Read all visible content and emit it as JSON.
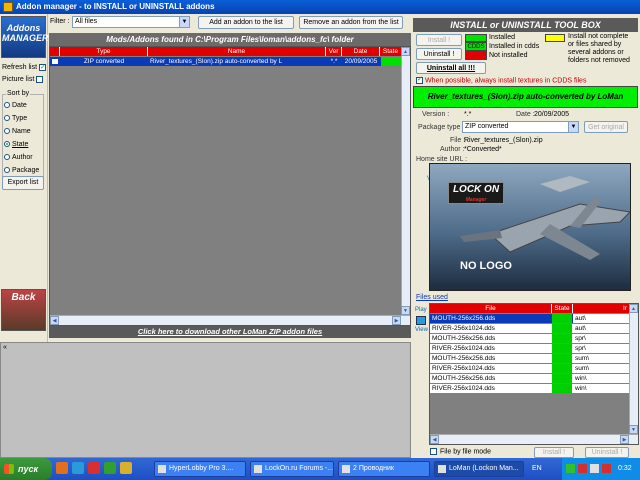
{
  "window": {
    "title": "Addon manager - to INSTALL or UNINSTALL addons"
  },
  "sidebar": {
    "logo_top": "Addons MANAGER",
    "refresh_list": "Refresh list",
    "picture_list": "Picture list",
    "sort_by": "Sort by",
    "sort_options": [
      "Date",
      "Type",
      "Name",
      "State",
      "Author",
      "Package"
    ],
    "selected_sort": "State",
    "export_list": "Export list",
    "back": "Back"
  },
  "toolbar": {
    "filter_label": "Filter :",
    "filter_value": "All files",
    "add_button": "Add an addon to the list",
    "remove_button": "Remove an addon from the list"
  },
  "mods": {
    "header": "Mods/Addons found in C:\\Program Files\\loman\\addons_fc\\ folder",
    "columns": [
      "Type",
      "Name",
      "Ver",
      "Date",
      "State",
      "Author"
    ],
    "rows": [
      {
        "type": "ZIP converted",
        "name": "River_textures_(Slon).zip auto-converted by L",
        "ver": "*.*",
        "date": "20/09/2005",
        "state_color": "#00e000",
        "author": "*Converted*"
      }
    ],
    "download_link": "Click here to download other LoMan ZIP addon files"
  },
  "toolbox": {
    "title": "INSTALL or UNINSTALL TOOL BOX",
    "install_button": "Install !",
    "uninstall_button": "Uninstall !",
    "uninstall_all_button": "Uninstall all !!!",
    "cdds_label": "CDDS",
    "legend_installed": "Installed",
    "legend_installed_cdds": "Installed in cdds",
    "legend_not_installed": "Not installed",
    "legend_incomplete": "Install not complete or files shared by several addons or folders not removed",
    "textures_checkbox": "When possible, always install textures in CDDS files",
    "banner": "River_textures_(Slon).zip auto-converted by LoMan",
    "version_label": "Version :",
    "version_value": "*.*",
    "date_label": "Date :",
    "date_value": "20/09/2005",
    "package_type_label": "Package type :",
    "package_type_value": "ZIP converted",
    "get_original_button": "Get original",
    "file_label": "File :",
    "file_value": "River_textures_(Slon).zip",
    "author_label": "Author :",
    "author_value": "*Converted*",
    "home_site_label": "Home site URL :",
    "view_label": "View",
    "preview_logo": "LOCK ON",
    "preview_logo_sub": "Manager",
    "preview_text": "NO LOGO",
    "files_used_label": "Files used",
    "play_label": "Play",
    "files_columns": [
      "File",
      "State",
      "Ir"
    ],
    "files": [
      {
        "file": "MOUTH-256x256.dds",
        "dir": "aut\\",
        "selected": true
      },
      {
        "file": "RIVER-256x1024.dds",
        "dir": "aut\\",
        "selected": false
      },
      {
        "file": "MOUTH-256x256.dds",
        "dir": "spr\\",
        "selected": false
      },
      {
        "file": "RIVER-256x1024.dds",
        "dir": "spr\\",
        "selected": false
      },
      {
        "file": "MOUTH-256x256.dds",
        "dir": "sum\\",
        "selected": false
      },
      {
        "file": "RIVER-256x1024.dds",
        "dir": "sum\\",
        "selected": false
      },
      {
        "file": "MOUTH-256x256.dds",
        "dir": "win\\",
        "selected": false
      },
      {
        "file": "RIVER-256x1024.dds",
        "dir": "win\\",
        "selected": false
      }
    ],
    "file_mode_label": "File by file mode",
    "install_bottom": "Install !",
    "uninstall_bottom": "Uninstall !"
  },
  "taskbar": {
    "start": "пуск",
    "tasks": [
      "HyperLobby Pro 3....",
      "LockOn.ru Forums -...",
      "2 Проводник",
      "LoMan (Lockon Man..."
    ],
    "active_task": 3,
    "lang": "EN",
    "clock": "0:32"
  },
  "colors": {
    "installed": "#00e000",
    "installed_cdds": "#00e000",
    "not_installed": "#e00000",
    "incomplete": "#ffff00",
    "header_red": "#e00000",
    "selection_blue": "#0a3ab8"
  }
}
